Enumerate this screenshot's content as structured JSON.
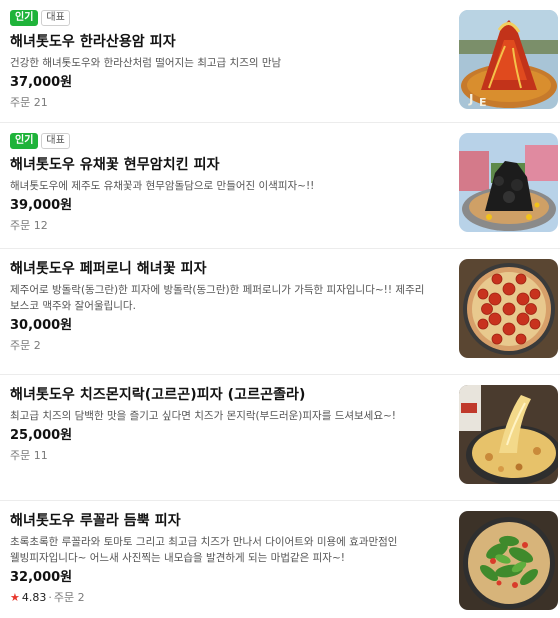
{
  "menu": {
    "items": [
      {
        "badges": [
          "인기",
          "대표"
        ],
        "name": "해녀톳도우 한라산용암 피자",
        "description": "건강한 해녀톳도우와 한라산처럼 떨어지는 최고급 치즈의 만남",
        "price": "37,000원",
        "orders": "주문 21",
        "image_icon": "lava-pizza-image"
      },
      {
        "badges": [
          "인기",
          "대표"
        ],
        "name": "해녀톳도우 유채꽃 현무암치킨 피자",
        "description": "해녀톳도우에 제주도 유채꽃과 현무암돌담으로 만들어진 이색피자~!!",
        "price": "39,000원",
        "orders": "주문 12",
        "image_icon": "basalt-chicken-pizza-image"
      },
      {
        "badges": [],
        "name": "해녀톳도우 페퍼로니 해녀꽃 피자",
        "description": "제주어로 방돌락(동그란)한 피자에 방돌락(동그란)한 페퍼로니가 가득한 피자입니다~!! 제주리 보스코 맥주와 잘어울립니다.",
        "price": "30,000원",
        "orders": "주문 2",
        "image_icon": "pepperoni-pizza-image"
      },
      {
        "badges": [],
        "name": "해녀톳도우 치즈몬지락(고르곤)피자 (고르곤졸라)",
        "description": "최고급 치즈의 담백한 맛을 즐기고 싶다면 치즈가 몬지락(부드러운)피자를 드셔보세요~!",
        "price": "25,000원",
        "orders": "주문 11",
        "image_icon": "gorgonzola-pizza-image"
      },
      {
        "badges": [],
        "name": "해녀톳도우 루꼴라 듬뿍 피자",
        "description": "초록초록한 루꼴라와 토마토 그리고 최고급 치즈가 만나서 다이어트와 미용에 효과만점인 웰빙피자입니다~ 어느새 사진찍는 내모습을 발견하게 되는 마법같은 피자~!",
        "price": "32,000원",
        "rating": "4.83",
        "orders": "주문 2",
        "image_icon": "arugula-pizza-image"
      }
    ]
  },
  "colors": {
    "badge_hot": "#1fb33a",
    "star": "#e8372c"
  },
  "icons": {
    "rating": "star-icon"
  }
}
